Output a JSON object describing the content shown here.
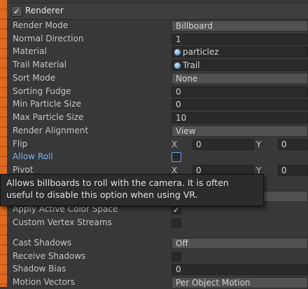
{
  "header": {
    "title": "Renderer",
    "enabled_mark": "✓"
  },
  "rows": {
    "render_mode": {
      "label": "Render Mode",
      "value": "Billboard"
    },
    "normal_direction": {
      "label": "Normal Direction",
      "value": "1"
    },
    "material": {
      "label": "Material",
      "value": "particlez"
    },
    "trail_material": {
      "label": "Trail Material",
      "value": "Trail"
    },
    "sort_mode": {
      "label": "Sort Mode",
      "value": "None"
    },
    "sorting_fudge": {
      "label": "Sorting Fudge",
      "value": "0"
    },
    "min_particle_size": {
      "label": "Min Particle Size",
      "value": "0"
    },
    "max_particle_size": {
      "label": "Max Particle Size",
      "value": "10"
    },
    "render_alignment": {
      "label": "Render Alignment",
      "value": "View"
    },
    "flip": {
      "label": "Flip",
      "x_label": "X",
      "x": "0",
      "y_label": "Y",
      "y": "0"
    },
    "allow_roll": {
      "label": "Allow Roll",
      "checked": false
    },
    "pivot": {
      "label": "Pivot",
      "x_label": "X",
      "x": "0",
      "y_label": "Y",
      "y": "0"
    },
    "apply_active_color_space": {
      "label": "Apply Active Color Space",
      "checked": true,
      "mark": "✓"
    },
    "custom_vertex_streams": {
      "label": "Custom Vertex Streams",
      "checked": false
    },
    "cast_shadows": {
      "label": "Cast Shadows",
      "value": "Off"
    },
    "receive_shadows": {
      "label": "Receive Shadows",
      "checked": false
    },
    "shadow_bias": {
      "label": "Shadow Bias",
      "value": "0"
    },
    "motion_vectors": {
      "label": "Motion Vectors",
      "value": "Per Object Motion"
    }
  },
  "tooltip": {
    "text": "Allows billboards to roll with the camera. It is often useful to disable this option when using VR."
  },
  "colors": {
    "accent_blue": "#7ab0f0",
    "focus_outline": "#5ea0ff",
    "gutter_orange": "#e06a1e"
  }
}
